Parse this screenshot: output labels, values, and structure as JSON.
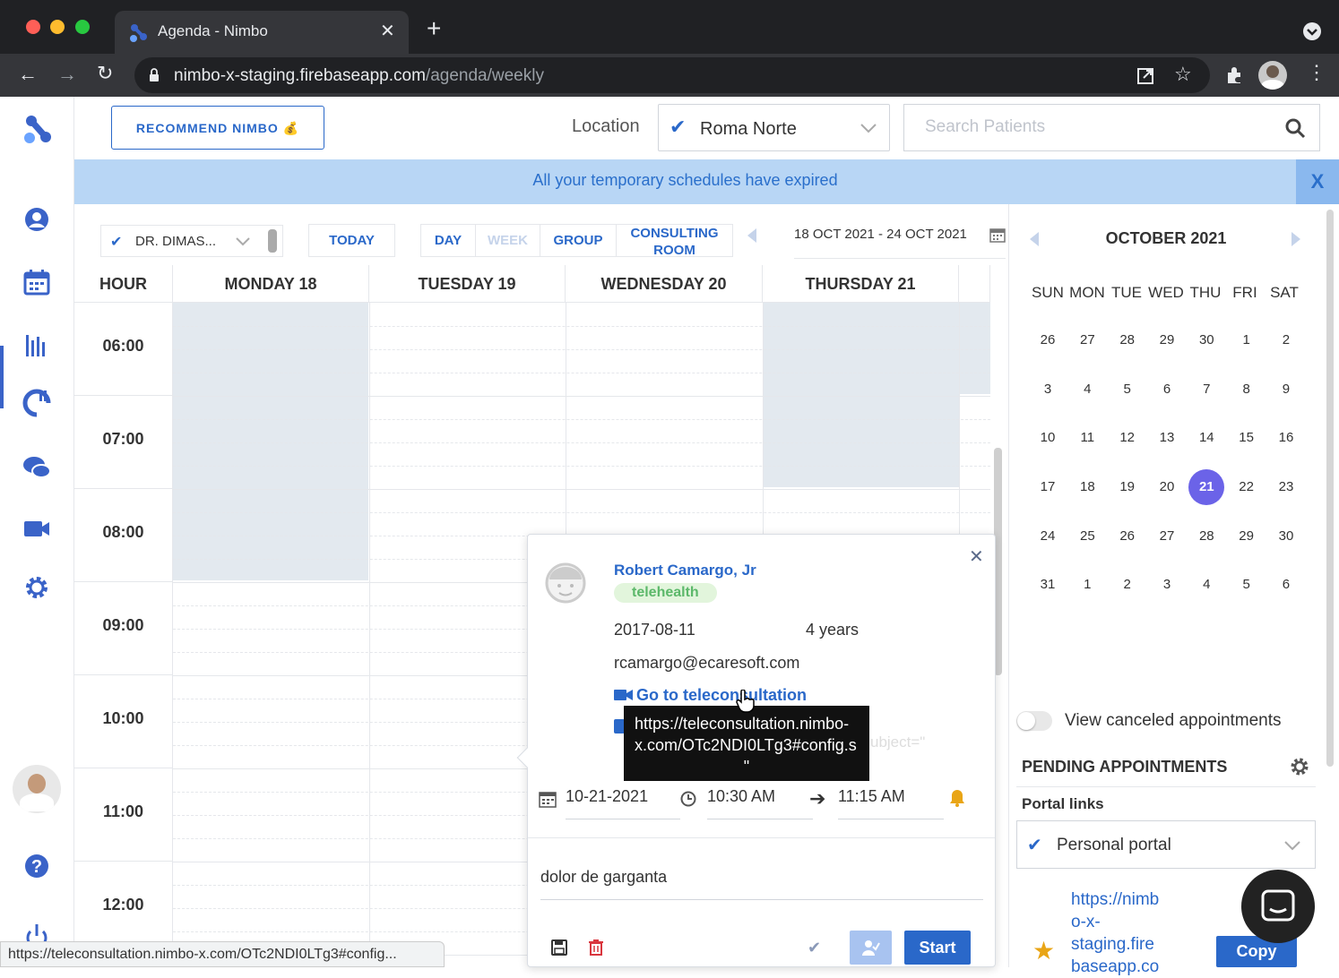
{
  "browser": {
    "tab_title": "Agenda - Nimbo",
    "url_host": "nimbo-x-staging.firebaseapp.com",
    "url_path": "/agenda/weekly",
    "status_url": "https://teleconsultation.nimbo-x.com/OTc2NDI0LTg3#config..."
  },
  "header": {
    "recommend_label": "RECOMMEND NIMBO",
    "location_label": "Location",
    "location_value": "Roma Norte",
    "search_placeholder": "Search Patients"
  },
  "banner": {
    "text": "All your temporary schedules have expired",
    "close": "X"
  },
  "toolbar": {
    "doctor": "DR. DIMAS...",
    "today": "TODAY",
    "views": [
      "DAY",
      "WEEK",
      "GROUP"
    ],
    "consulting_1": "CONSULTING",
    "consulting_2": "ROOM",
    "range": "18 OCT 2021 - 24 OCT 2021"
  },
  "grid": {
    "hour_header": "HOUR",
    "days": [
      "MONDAY 18",
      "TUESDAY 19",
      "WEDNESDAY 20",
      "THURSDAY 21"
    ],
    "hours": [
      "06:00",
      "07:00",
      "08:00",
      "09:00",
      "10:00",
      "11:00",
      "12:00"
    ]
  },
  "mini_calendar": {
    "title": "OCTOBER 2021",
    "weekdays": [
      "SUN",
      "MON",
      "TUE",
      "WED",
      "THU",
      "FRI",
      "SAT"
    ],
    "weeks": [
      [
        "26",
        "27",
        "28",
        "29",
        "30",
        "1",
        "2"
      ],
      [
        "3",
        "4",
        "5",
        "6",
        "7",
        "8",
        "9"
      ],
      [
        "10",
        "11",
        "12",
        "13",
        "14",
        "15",
        "16"
      ],
      [
        "17",
        "18",
        "19",
        "20",
        "21",
        "22",
        "23"
      ],
      [
        "24",
        "25",
        "26",
        "27",
        "28",
        "29",
        "30"
      ],
      [
        "31",
        "1",
        "2",
        "3",
        "4",
        "5",
        "6"
      ]
    ],
    "selected": "21"
  },
  "right_panel": {
    "view_canceled": "View canceled appointments",
    "pending_title": "PENDING APPOINTMENTS",
    "portal_links": "Portal links",
    "portal_select": "Personal portal",
    "portal_url_lines": [
      "https://nimb",
      "o-x-",
      "staging.fire",
      "baseapp.co"
    ],
    "copy": "Copy"
  },
  "popup": {
    "patient_name": "Robert Camargo, Jr",
    "tag": "telehealth",
    "dob": "2017-08-11",
    "age": "4 years",
    "email": "rcamargo@ecaresoft.com",
    "teleconsult_link": "Go to teleconsultation",
    "hidden_text": "ubject=\"",
    "date": "10-21-2021",
    "start_time": "10:30 AM",
    "end_time": "11:15 AM",
    "reason": "dolor de garganta",
    "start_button": "Start"
  },
  "tooltip": {
    "line1": "https://teleconsultation.nimbo-",
    "line2": "x.com/OTc2NDI0LTg3#config.s",
    "line3": "\""
  },
  "colors": {
    "primary": "#2a68c9",
    "selected_day": "#6b63e8",
    "banner_bg": "#b8d6f5",
    "shade": "#e3e9ef"
  }
}
